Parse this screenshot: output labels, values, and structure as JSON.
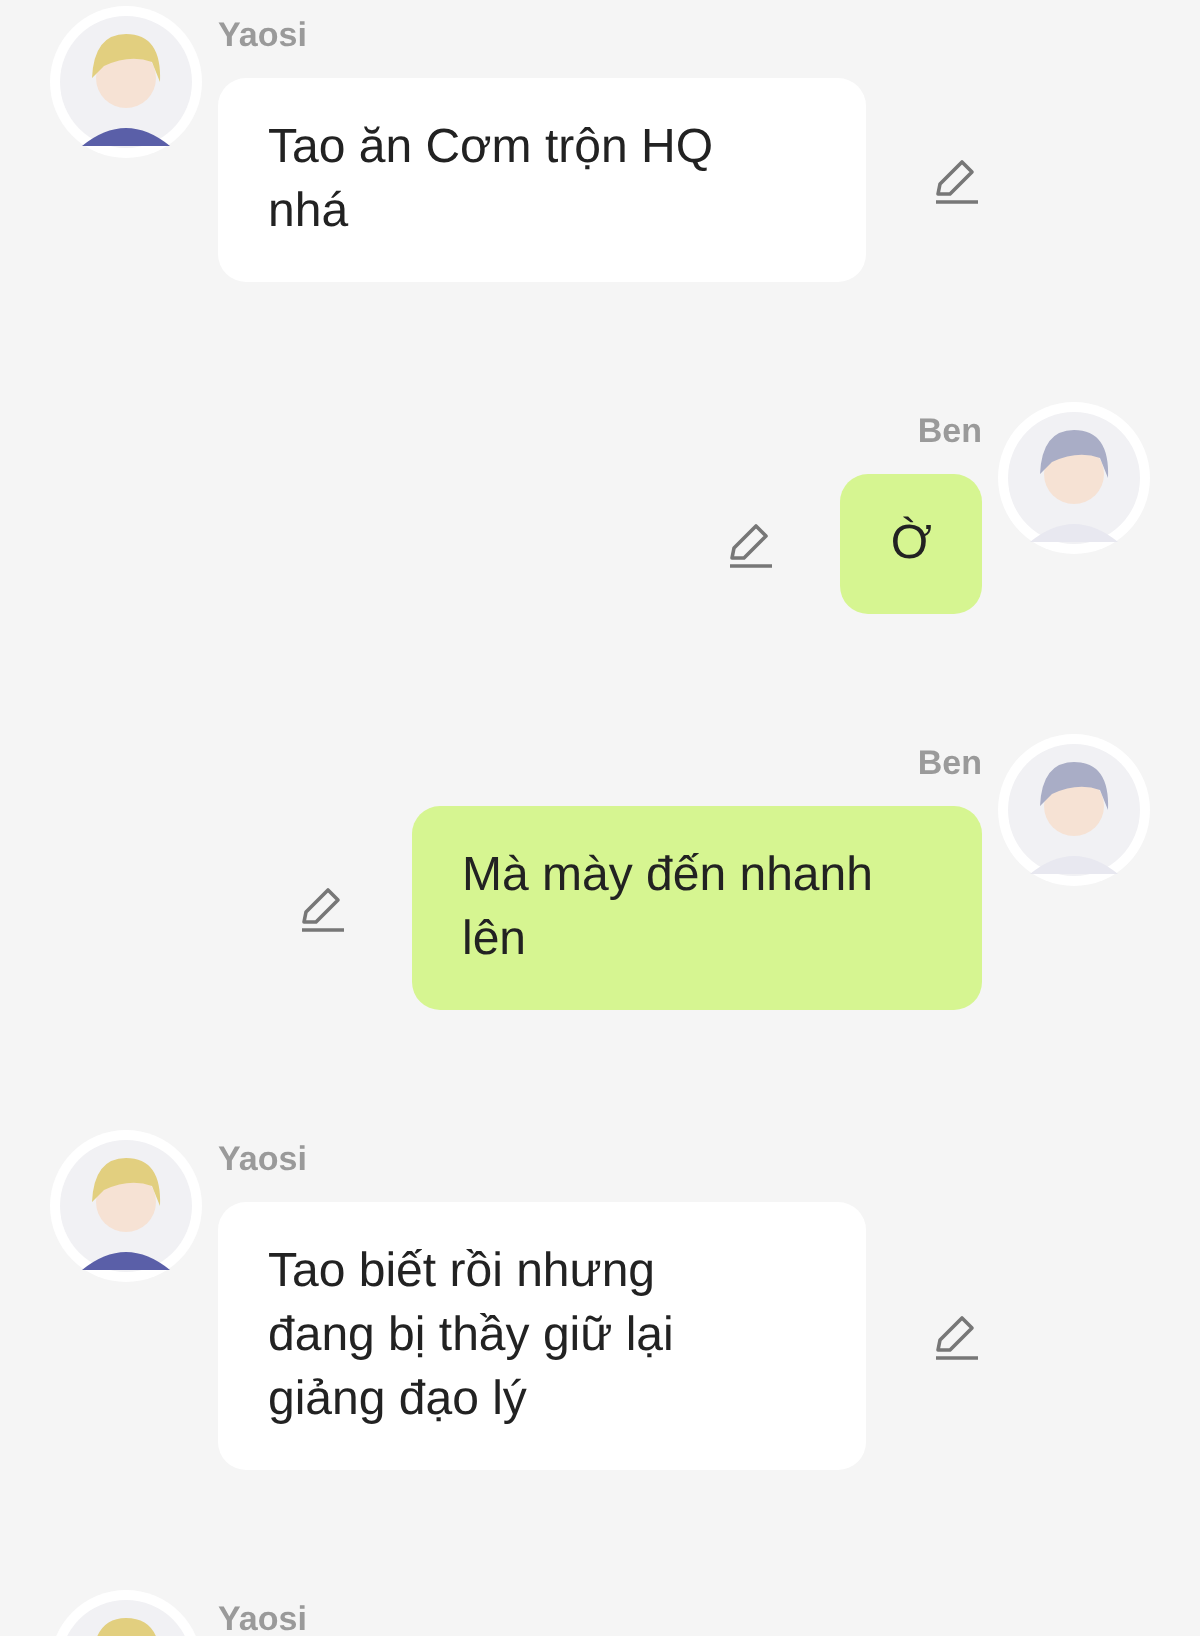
{
  "messages": [
    {
      "sender": "Yaosi",
      "kind": "incoming",
      "text": "Tao ăn Cơm trộn HQ nhá"
    },
    {
      "sender": "Ben",
      "kind": "outgoing",
      "text": "Ờ"
    },
    {
      "sender": "Ben",
      "kind": "outgoing",
      "text": "Mà mày đến nhanh lên"
    },
    {
      "sender": "Yaosi",
      "kind": "incoming",
      "text": "Tao biết rồi nhưng đang bị thầy giữ lại giảng đạo lý"
    },
    {
      "sender": "Yaosi",
      "kind": "incoming"
    }
  ]
}
